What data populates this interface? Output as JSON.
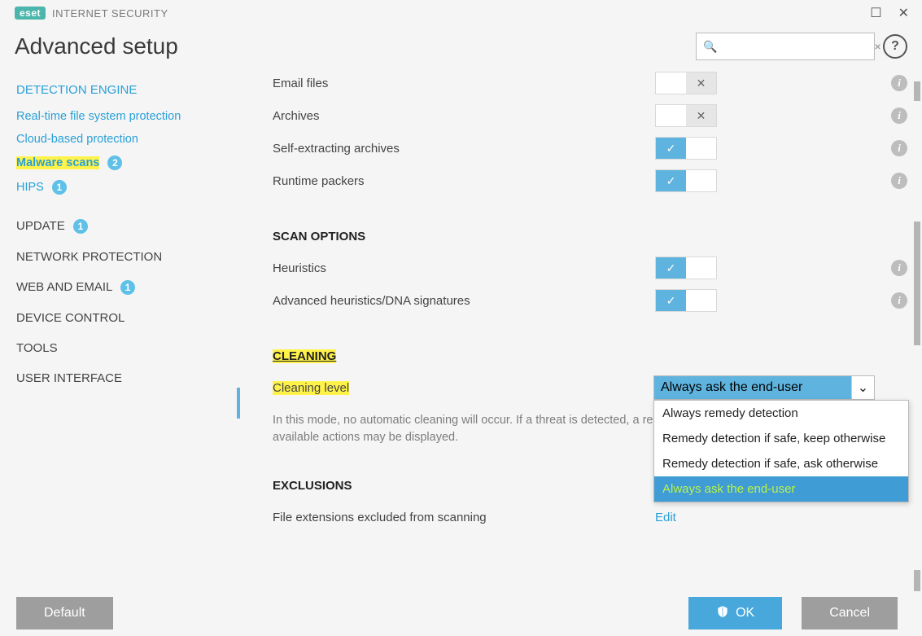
{
  "titlebar": {
    "brand": "eset",
    "product": "INTERNET SECURITY"
  },
  "header": {
    "title": "Advanced setup",
    "search_placeholder": "",
    "clear": "×",
    "help": "?"
  },
  "sidebar": {
    "detection_engine": "DETECTION ENGINE",
    "realtime": "Real-time file system protection",
    "cloud": "Cloud-based protection",
    "malware": "Malware scans",
    "malware_badge": "2",
    "hips": "HIPS",
    "hips_badge": "1",
    "update": "UPDATE",
    "update_badge": "1",
    "network": "NETWORK PROTECTION",
    "web": "WEB AND EMAIL",
    "web_badge": "1",
    "device": "DEVICE CONTROL",
    "tools": "TOOLS",
    "ui": "USER INTERFACE"
  },
  "rows": {
    "email_files": "Email files",
    "archives": "Archives",
    "self_extracting": "Self-extracting archives",
    "runtime_packers": "Runtime packers"
  },
  "scan_options": {
    "header": "SCAN OPTIONS",
    "heuristics": "Heuristics",
    "adv_heuristics": "Advanced heuristics/DNA signatures"
  },
  "cleaning": {
    "header": "CLEANING",
    "level_label": "Cleaning level",
    "selected": "Always ask the end-user",
    "options": {
      "o1": "Always remedy detection",
      "o2": "Remedy detection if safe, keep otherwise",
      "o3": "Remedy detection if safe, ask otherwise",
      "o4": "Always ask the end-user"
    },
    "description": "In this mode, no automatic cleaning will occur. If a threat is detected, a red alert window with a list of available actions may be displayed."
  },
  "exclusions": {
    "header": "EXCLUSIONS",
    "label": "File extensions excluded from scanning",
    "edit": "Edit"
  },
  "footer": {
    "default": "Default",
    "ok": "OK",
    "cancel": "Cancel"
  }
}
